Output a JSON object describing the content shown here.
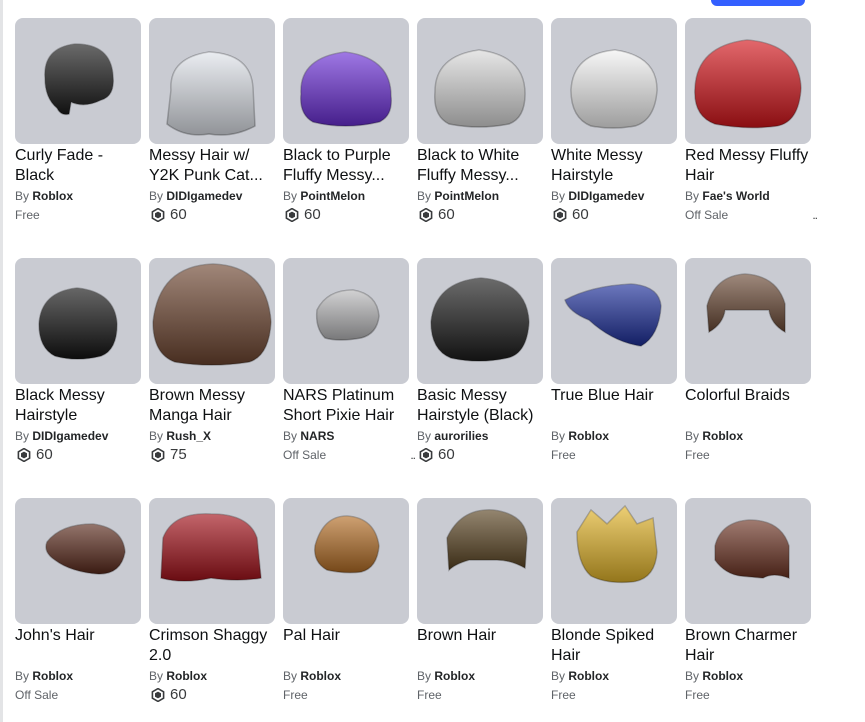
{
  "items": [
    {
      "name": "Curly Fade - Black",
      "creator": "Roblox",
      "price": "Free",
      "price_type": "text",
      "icon": "curly-black-hair-icon",
      "hair_color": "#1a1a1a"
    },
    {
      "name": "Messy Hair w/ Y2K Punk Cat...",
      "creator": "DIDIgamedev",
      "price": "60",
      "price_type": "robux",
      "icon": "white-cat-beanie-hair-icon",
      "hair_color": "#dfe3ea"
    },
    {
      "name": "Black to Purple Fluffy Messy...",
      "creator": "PointMelon",
      "price": "60",
      "price_type": "robux",
      "icon": "black-purple-hair-icon",
      "hair_color": "#6b2fd6"
    },
    {
      "name": "Black to White Fluffy Messy...",
      "creator": "PointMelon",
      "price": "60",
      "price_type": "robux",
      "icon": "black-white-hair-icon",
      "hair_color": "#d9d9d9"
    },
    {
      "name": "White Messy Hairstyle",
      "creator": "DIDIgamedev",
      "price": "60",
      "price_type": "robux",
      "icon": "white-messy-hair-icon",
      "hair_color": "#f2f2f2"
    },
    {
      "name": "Red Messy Fluffy Hair",
      "creator": "Fae's World",
      "price": "Off Sale",
      "price_type": "text",
      "icon": "red-messy-hair-icon",
      "hair_color": "#d4161c",
      "more": ".."
    },
    {
      "name": "Black Messy Hairstyle",
      "creator": "DIDIgamedev",
      "price": "60",
      "price_type": "robux",
      "icon": "black-messy-hair-icon",
      "hair_color": "#141414"
    },
    {
      "name": "Brown Messy Manga Hair",
      "creator": "Rush_X",
      "price": "75",
      "price_type": "robux",
      "icon": "brown-manga-hair-icon",
      "hair_color": "#6e4631"
    },
    {
      "name": "NARS Platinum Short Pixie Hair",
      "creator": "NARS",
      "price": "Off Sale",
      "price_type": "text",
      "icon": "platinum-pixie-hair-icon",
      "hair_color": "#b9b9bb",
      "more": ".."
    },
    {
      "name": "Basic Messy Hairstyle (Black)",
      "creator": "aurorilies",
      "price": "60",
      "price_type": "robux",
      "icon": "basic-black-hair-icon",
      "hair_color": "#1c1c1c"
    },
    {
      "name": "True Blue Hair",
      "creator": "Roblox",
      "price": "Free",
      "price_type": "text",
      "icon": "blue-hair-icon",
      "hair_color": "#1d2f9a"
    },
    {
      "name": "Colorful Braids",
      "creator": "Roblox",
      "price": "Free",
      "price_type": "text",
      "icon": "colorful-braids-icon",
      "hair_color": "#6b4a36"
    },
    {
      "name": "John's Hair",
      "creator": "Roblox",
      "price": "Off Sale",
      "price_type": "text",
      "icon": "johns-hair-icon",
      "hair_color": "#5a2a1c"
    },
    {
      "name": "Crimson Shaggy 2.0",
      "creator": "Roblox",
      "price": "60",
      "price_type": "robux",
      "icon": "crimson-shaggy-hair-icon",
      "hair_color": "#a3121b"
    },
    {
      "name": "Pal Hair",
      "creator": "Roblox",
      "price": "Free",
      "price_type": "text",
      "icon": "pal-hair-icon",
      "hair_color": "#b46e26"
    },
    {
      "name": "Brown Hair",
      "creator": "Roblox",
      "price": "Free",
      "price_type": "text",
      "icon": "brown-hair-icon",
      "hair_color": "#5a4422"
    },
    {
      "name": "Blonde Spiked Hair",
      "creator": "Roblox",
      "price": "Free",
      "price_type": "text",
      "icon": "blonde-spiked-hair-icon",
      "hair_color": "#e3b52a"
    },
    {
      "name": "Brown Charmer Hair",
      "creator": "Roblox",
      "price": "Free",
      "price_type": "text",
      "icon": "brown-charmer-hair-icon",
      "hair_color": "#6d3424"
    }
  ],
  "labels": {
    "by": "By"
  },
  "colors": {
    "thumb_bg": "#c9cbd2",
    "accent": "#335fff"
  }
}
